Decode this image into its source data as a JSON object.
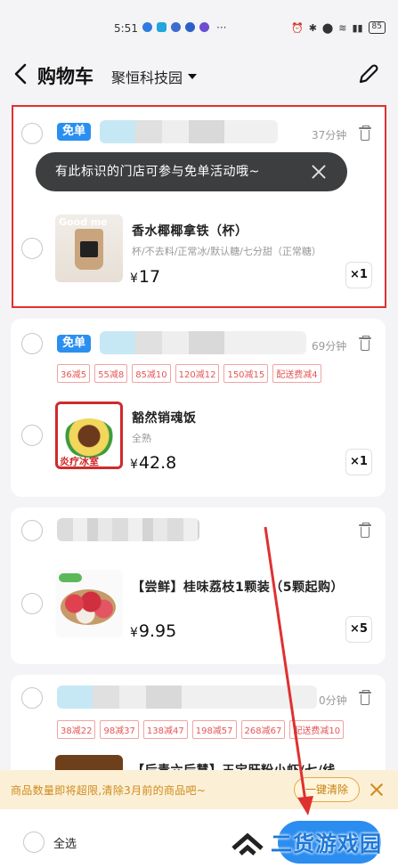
{
  "status_bar": {
    "time": "5:51",
    "more": "···",
    "battery": "85"
  },
  "header": {
    "title": "购物车",
    "location": "聚恒科技园"
  },
  "tooltip": {
    "text": "有此标识的门店可参与免单活动哦~"
  },
  "stores": [
    {
      "badge": "免单",
      "time": "37分钟",
      "product": {
        "name": "香水椰椰拿铁（杯）",
        "spec": "杯/不去料/正常冰/默认糖/七分甜（正常糖）",
        "price": "17",
        "qty": "×1",
        "thumb_text": "Good me"
      }
    },
    {
      "badge": "免单",
      "time": "69分钟",
      "coupons": [
        "36减5",
        "55减8",
        "85减10",
        "120减12",
        "150减15",
        "配送费减4"
      ],
      "product": {
        "name": "豁然销魂饭",
        "spec": "全熟",
        "price": "42.8",
        "qty": "×1",
        "thumb_text": "炎疗冰室"
      }
    },
    {
      "product": {
        "name": "【尝鲜】桂味荔枝1颗装（5颗起购）",
        "price": "9.95",
        "qty": "×5"
      }
    },
    {
      "time": "0分钟",
      "coupons": [
        "38减22",
        "98减37",
        "138减47",
        "198减57",
        "268减67",
        "配送费减10"
      ],
      "product": {
        "name": "【后青六后慧】王宝肝粉小虾/七/线",
        "price": ""
      }
    }
  ],
  "currency": "¥",
  "notice": {
    "text": "商品数量即将超限,清除3月前的商品吧~",
    "button": "一键清除"
  },
  "footer": {
    "select_all": "全选"
  },
  "watermark": {
    "text": "二货游戏园"
  },
  "colors": {
    "accent": "#2b8df0",
    "coupon": "#e45656",
    "notice": "#d08a1b",
    "annotation": "#e03030"
  }
}
